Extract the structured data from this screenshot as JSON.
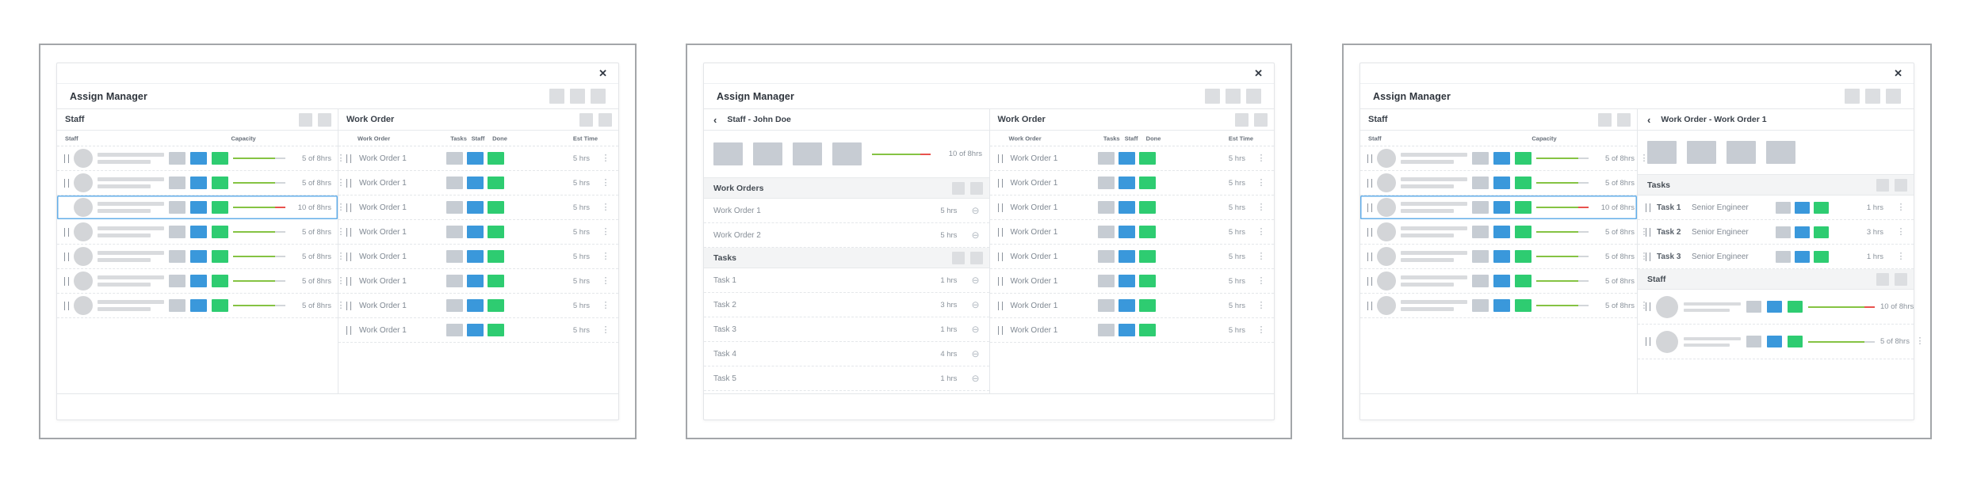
{
  "colors": {
    "accent_blue": "#3a98db",
    "accent_green": "#2ecc71",
    "neutral_square": "#c6ccd3",
    "progress_green": "#85c343",
    "progress_over_red": "#e8524d",
    "progress_track": "#d2d6da",
    "selected_border": "#63aee9"
  },
  "icons": {
    "close": "✕",
    "kebab": "⋮",
    "back": "‹",
    "remove": "⊖"
  },
  "panel1": {
    "title": "Assign Manager",
    "staff": {
      "section_title": "Staff",
      "col_staff": "Staff",
      "col_capacity": "Capacity",
      "rows": [
        {
          "capacity": "5 of 8hrs"
        },
        {
          "capacity": "5 of 8hrs"
        },
        {
          "capacity": "10 of 8hrs"
        },
        {
          "capacity": "5 of 8hrs"
        },
        {
          "capacity": "5 of 8hrs"
        },
        {
          "capacity": "5 of 8hrs"
        },
        {
          "capacity": "5 of 8hrs"
        }
      ]
    },
    "work_order": {
      "section_title": "Work Order",
      "col_work_order": "Work Order",
      "col_tasks": "Tasks",
      "col_staff": "Staff",
      "col_done": "Done",
      "col_est_time": "Est Time",
      "rows": [
        {
          "label": "Work Order 1",
          "est_time": "5 hrs"
        },
        {
          "label": "Work Order 1",
          "est_time": "5 hrs"
        },
        {
          "label": "Work Order 1",
          "est_time": "5 hrs"
        },
        {
          "label": "Work Order 1",
          "est_time": "5 hrs"
        },
        {
          "label": "Work Order 1",
          "est_time": "5 hrs"
        },
        {
          "label": "Work Order 1",
          "est_time": "5 hrs"
        },
        {
          "label": "Work Order 1",
          "est_time": "5 hrs"
        },
        {
          "label": "Work Order 1",
          "est_time": "5 hrs"
        }
      ]
    }
  },
  "panel2": {
    "title": "Assign Manager",
    "detail": {
      "breadcrumb": "Staff - John Doe",
      "capacity": "10 of 8hrs",
      "work_orders_title": "Work Orders",
      "work_orders": [
        {
          "label": "Work Order 1",
          "hrs": "5 hrs"
        },
        {
          "label": "Work Order 2",
          "hrs": "5 hrs"
        }
      ],
      "tasks_title": "Tasks",
      "tasks": [
        {
          "label": "Task 1",
          "hrs": "1 hrs"
        },
        {
          "label": "Task 2",
          "hrs": "3 hrs"
        },
        {
          "label": "Task 3",
          "hrs": "1 hrs"
        },
        {
          "label": "Task 4",
          "hrs": "4 hrs"
        },
        {
          "label": "Task 5",
          "hrs": "1 hrs"
        }
      ]
    },
    "work_order": {
      "section_title": "Work Order",
      "col_work_order": "Work Order",
      "col_tasks": "Tasks",
      "col_staff": "Staff",
      "col_done": "Done",
      "col_est_time": "Est Time",
      "rows": [
        {
          "label": "Work Order 1",
          "est_time": "5 hrs"
        },
        {
          "label": "Work Order 1",
          "est_time": "5 hrs"
        },
        {
          "label": "Work Order 1",
          "est_time": "5 hrs"
        },
        {
          "label": "Work Order 1",
          "est_time": "5 hrs"
        },
        {
          "label": "Work Order 1",
          "est_time": "5 hrs"
        },
        {
          "label": "Work Order 1",
          "est_time": "5 hrs"
        },
        {
          "label": "Work Order 1",
          "est_time": "5 hrs"
        },
        {
          "label": "Work Order 1",
          "est_time": "5 hrs"
        }
      ]
    }
  },
  "panel3": {
    "title": "Assign Manager",
    "staff": {
      "section_title": "Staff",
      "col_staff": "Staff",
      "col_capacity": "Capacity",
      "rows": [
        {
          "capacity": "5 of 8hrs"
        },
        {
          "capacity": "5 of 8hrs"
        },
        {
          "capacity": "10 of 8hrs"
        },
        {
          "capacity": "5 of 8hrs"
        },
        {
          "capacity": "5 of 8hrs"
        },
        {
          "capacity": "5 of 8hrs"
        },
        {
          "capacity": "5 of 8hrs"
        }
      ]
    },
    "detail": {
      "breadcrumb": "Work Order - Work Order 1",
      "tasks_title": "Tasks",
      "tasks": [
        {
          "label": "Task 1",
          "role": "Senior Engineer",
          "hrs": "1 hrs"
        },
        {
          "label": "Task 2",
          "role": "Senior Engineer",
          "hrs": "3 hrs"
        },
        {
          "label": "Task 3",
          "role": "Senior Engineer",
          "hrs": "1 hrs"
        }
      ],
      "staff_title": "Staff",
      "staff_rows": [
        {
          "capacity": "10 of 8hrs"
        },
        {
          "capacity": "5 of 8hrs"
        }
      ]
    }
  }
}
